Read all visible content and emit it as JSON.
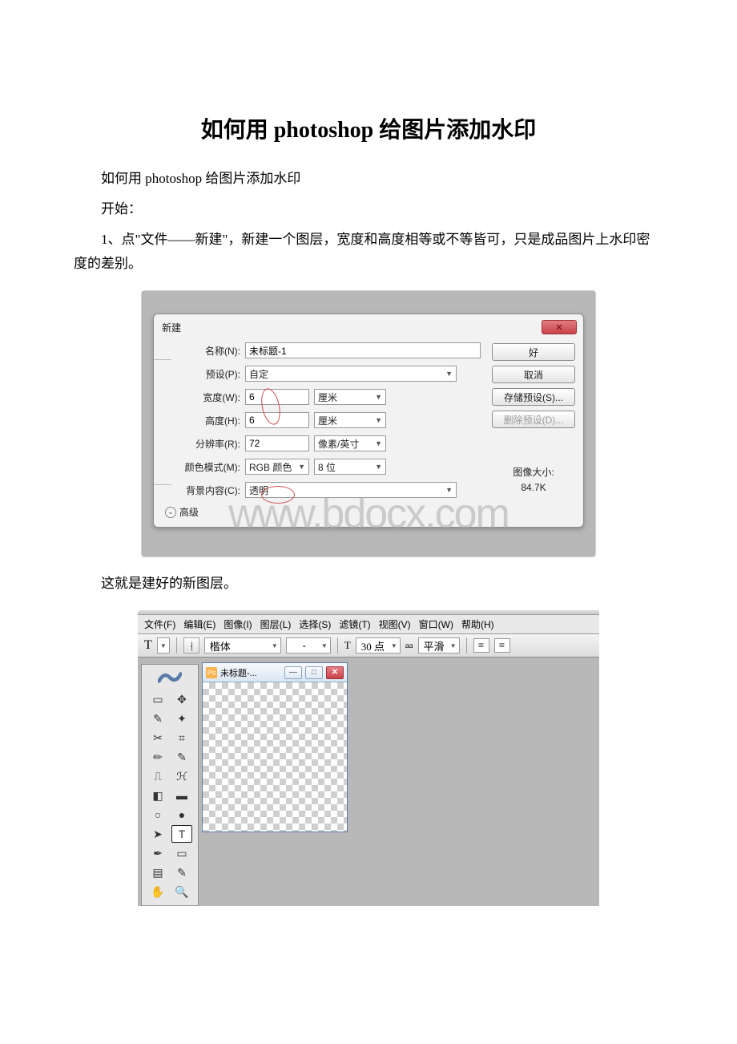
{
  "doc": {
    "title": "如何用 photoshop 给图片添加水印",
    "p1": "如何用 photoshop 给图片添加水印",
    "p2": "开始：",
    "p3": "1、点\"文件——新建\"，新建一个图层，宽度和高度相等或不等皆可，只是成品图片上水印密度的差别。",
    "p4": "这就是建好的新图层。"
  },
  "dialog": {
    "title": "新建",
    "close": "✕",
    "name_label": "名称(N):",
    "name_value": "未标题-1",
    "preset_label": "预设(P):",
    "preset_value": "自定",
    "width_label": "宽度(W):",
    "width_value": "6",
    "width_unit": "厘米",
    "height_label": "高度(H):",
    "height_value": "6",
    "height_unit": "厘米",
    "res_label": "分辨率(R):",
    "res_value": "72",
    "res_unit": "像素/英寸",
    "mode_label": "颜色模式(M):",
    "mode_value": "RGB 颜色",
    "mode_bits": "8 位",
    "bg_label": "背景内容(C):",
    "bg_value": "透明",
    "advanced": "高级",
    "btn_ok": "好",
    "btn_cancel": "取消",
    "btn_save": "存储预设(S)...",
    "btn_delete": "删除预设(D)...",
    "size_label": "图像大小:",
    "size_value": "84.7K",
    "watermark": "www.bdocx.com"
  },
  "ps": {
    "menus": [
      "文件(F)",
      "编辑(E)",
      "图像(I)",
      "图层(L)",
      "选择(S)",
      "滤镜(T)",
      "视图(V)",
      "窗口(W)",
      "帮助(H)"
    ],
    "opt_t": "T",
    "opt_font": "楷体",
    "opt_style": "-",
    "opt_sizeglyph": "T",
    "opt_size": "30 点",
    "opt_aa_label": "aa",
    "opt_aa": "平滑",
    "doc_title": "未标题-..."
  }
}
